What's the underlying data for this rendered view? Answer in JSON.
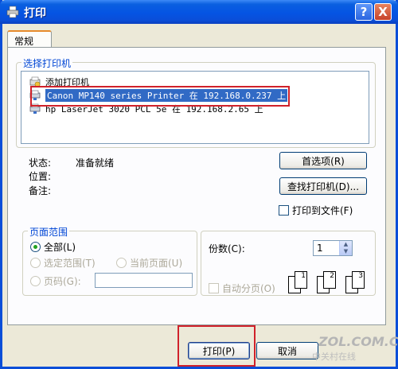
{
  "window": {
    "title": "打印",
    "help_label": "?",
    "close_label": "X"
  },
  "tabs": [
    {
      "label": "常规"
    }
  ],
  "printer_group": {
    "title": "选择打印机",
    "printers": [
      {
        "label": "添加打印机",
        "icon": "add-printer-icon"
      },
      {
        "label": "Canon MP140 series Printer 在 192.168.0.237 上",
        "icon": "network-printer-icon",
        "selected": true
      },
      {
        "label": "hp LaserJet 3020 PCL 5e 在 192.168.2.65 上",
        "icon": "network-printer-icon"
      }
    ]
  },
  "status": {
    "status_label": "状态:",
    "status_value": "准备就绪",
    "location_label": "位置:",
    "comment_label": "备注:"
  },
  "buttons": {
    "preferences": "首选项(R)",
    "find_printer": "查找打印机(D)...",
    "print": "打印(P)",
    "cancel": "取消"
  },
  "print_to_file": {
    "label": "打印到文件(F)",
    "checked": false
  },
  "page_range": {
    "title": "页面范围",
    "all": "全部(L)",
    "selection": "选定范围(T)",
    "current_page": "当前页面(U)",
    "pages": "页码(G):",
    "pages_value": ""
  },
  "copies": {
    "label": "份数(C):",
    "value": "1",
    "collate_label": "自动分页(O)",
    "collate_pages": [
      "1",
      "1",
      "2",
      "2",
      "3",
      "3"
    ]
  },
  "watermark": {
    "site": "ZOL.COM.CN",
    "sub": "中关村在线"
  },
  "colors": {
    "titlebar": "#0a4ed8",
    "group_title": "#0046d5",
    "selection": "#316ac5",
    "highlight": "#d0212a"
  }
}
